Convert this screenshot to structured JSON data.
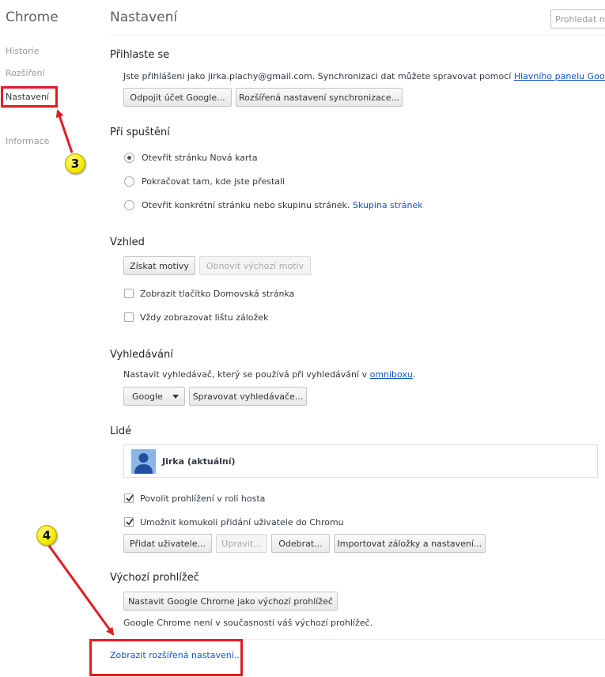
{
  "sidebar": {
    "title": "Chrome",
    "items": [
      {
        "label": "Historie"
      },
      {
        "label": "Rozšíření"
      },
      {
        "label": "Nastavení"
      },
      {
        "label": "Informace"
      }
    ]
  },
  "header": {
    "title": "Nastavení",
    "search_placeholder": "Prohledat nastavení"
  },
  "signin": {
    "heading": "Přihlaste se",
    "text": "Jste přihlášeni jako jirka.plachy@gmail.com. Synchronizaci dat můžete spravovat pomocí ",
    "link": "Hlavního panelu Google",
    "text_end": ".",
    "disconnect_button": "Odpojit účet Google...",
    "advanced_sync_button": "Rozšířená nastavení synchronizace..."
  },
  "startup": {
    "heading": "Při spuštění",
    "options": [
      {
        "label": "Otevřít stránku Nová karta",
        "selected": true
      },
      {
        "label": "Pokračovat tam, kde jste přestali",
        "selected": false
      },
      {
        "label": "Otevřít konkrétní stránku nebo skupinu stránek.",
        "selected": false
      }
    ],
    "pages_link": "Skupina stránek"
  },
  "appearance": {
    "heading": "Vzhled",
    "get_themes_button": "Získat motivy",
    "reset_theme_button": "Obnovit výchozí motiv",
    "checkboxes": [
      {
        "label": "Zobrazit tlačítko Domovská stránka",
        "checked": false
      },
      {
        "label": "Vždy zobrazovat lištu záložek",
        "checked": false
      }
    ]
  },
  "search": {
    "heading": "Vyhledávání",
    "text": "Nastavit vyhledávač, který se používá při vyhledávání v ",
    "link": "omniboxu",
    "text_end": ".",
    "engine_select": "Google",
    "manage_button": "Spravovat vyhledávače..."
  },
  "people": {
    "heading": "Lidé",
    "profile_name": "Jirka (aktuální)",
    "checkboxes": [
      {
        "label": "Povolit prohlížení v roli hosta",
        "checked": true
      },
      {
        "label": "Umožnit komukoli přidání uživatele do Chromu",
        "checked": true
      }
    ],
    "add_button": "Přidat uživatele...",
    "edit_button": "Upravit...",
    "remove_button": "Odebrat...",
    "import_button": "Importovat záložky a nastavení..."
  },
  "default_browser": {
    "heading": "Výchozí prohlížeč",
    "set_default_button": "Nastavit Google Chrome jako výchozí prohlížeč",
    "status": "Google Chrome není v současnosti váš výchozí prohlížeč."
  },
  "advanced_link": "Zobrazit rozšířená nastavení...",
  "annotations": {
    "badge_3": "3",
    "badge_4": "4",
    "highlight_color": "#e31b23",
    "badge_color": "#f4e800"
  }
}
